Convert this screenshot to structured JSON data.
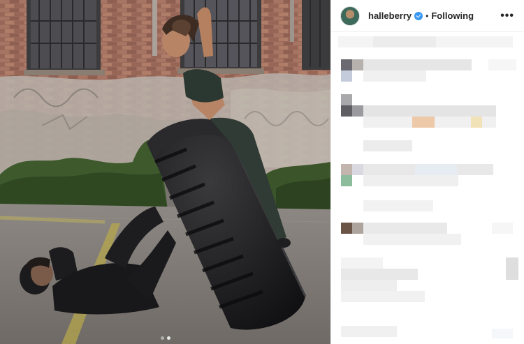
{
  "post": {
    "username": "halleberry",
    "follow_status": "Following",
    "separator": "•",
    "more_options": "•••",
    "carousel": {
      "total_slides": 2,
      "active_slide": 2
    }
  },
  "icons": {
    "verified": "verified-badge-icon",
    "more": "more-options-icon"
  },
  "colors": {
    "verified_blue": "#3897f0",
    "text_dark": "#262626",
    "divider": "#efefef"
  }
}
